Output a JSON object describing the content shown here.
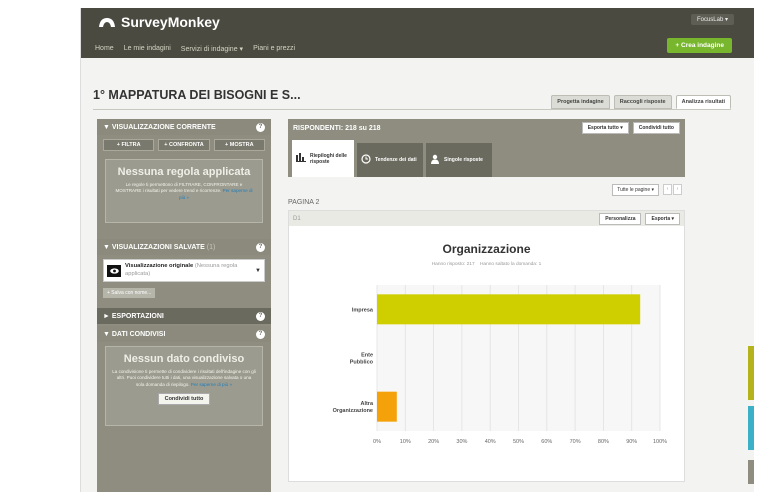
{
  "header": {
    "brand": "SurveyMonkey",
    "nav": [
      "Home",
      "Le mie indagini",
      "Servizi di indagine ▾",
      "Piani e prezzi"
    ],
    "account": "FocusLab ▾",
    "create_button": "+ Crea indagine"
  },
  "page": {
    "title": "1° MAPPATURA DEI BISOGNI E S...",
    "tabs": [
      "Progetta indagine",
      "Raccogli risposte",
      "Analizza risultati"
    ],
    "active_tab": "Analizza risultati"
  },
  "left": {
    "current_view": {
      "header": "▼ VISUALIZZAZIONE CORRENTE",
      "buttons": [
        "+ FILTRA",
        "+ CONFRONTA",
        "+ MOSTRA"
      ],
      "empty_title": "Nessuna regola applicata",
      "empty_text": "Le regole ti permettono di FILTRARE, CONFRONTARE e MOSTRARE i risultati per vedere trend e ricorrenze.",
      "empty_link": "Per saperne di più »"
    },
    "saved_views": {
      "header": "▼ VISUALIZZAZIONI SALVATE",
      "count": "(1)",
      "item_title": "Visualizzazione originale",
      "item_note": "(Nessuna regola applicata)",
      "save_as": "+ Salva con nome..."
    },
    "exports": {
      "header": "► ESPORTAZIONI"
    },
    "shared": {
      "header": "▼ DATI CONDIVISI",
      "empty_title": "Nessun dato condiviso",
      "empty_text": "La condivisione ti permette di condividere i risultati dell'indagine con gli altri. Puoi condividere tutti i dati, una visualizzazione salvata o una sola domanda di riepilogo.",
      "empty_link": "Per saperne di più »",
      "share_button": "Condividi tutto"
    }
  },
  "right": {
    "respondents": "RISPONDENTI: 218 su 218",
    "export_all": "Esporta tutto ▾",
    "share_all": "Condividi tutto",
    "subtabs": [
      "Riepiloghi delle risposte",
      "Tendenze dei dati",
      "Singole risposte"
    ],
    "all_pages": "Tutte le pagine ▾",
    "page_label": "PAGINA 2",
    "question_id": "D1",
    "customize": "Personalizza",
    "export": "Esporta ▾",
    "answered": "Hanno risposto: 217",
    "skipped": "Hanno saltato la domanda: 1"
  },
  "colors": {
    "header_bg": "#4b4a40",
    "create_green": "#78b72d",
    "panel_gray": "#8e8d80",
    "bar_yellow": "#cfcf00",
    "bar_orange": "#f5a20a",
    "accent_blue": "#1e7fbd"
  },
  "chart_data": {
    "type": "bar",
    "orientation": "horizontal",
    "title": "Organizzazione",
    "categories": [
      "Impresa",
      "Ente Pubblico",
      "Altra Organizzazione"
    ],
    "values": [
      93,
      0,
      7
    ],
    "value_unit": "%",
    "xlim": [
      0,
      100
    ],
    "xticks": [
      "0%",
      "10%",
      "20%",
      "30%",
      "40%",
      "50%",
      "60%",
      "70%",
      "80%",
      "90%",
      "100%"
    ],
    "bar_colors": [
      "#cfcf00",
      "#cfcf00",
      "#f5a20a"
    ],
    "grid": true,
    "legend": "none"
  }
}
